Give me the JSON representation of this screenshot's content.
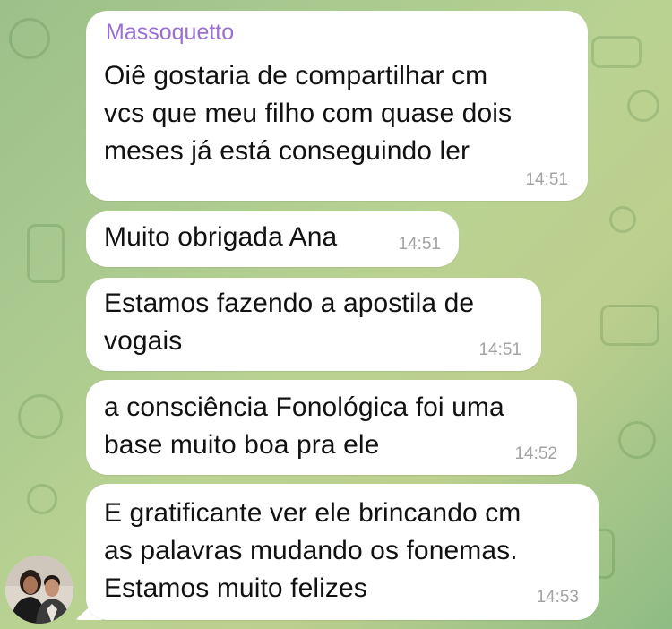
{
  "chat": {
    "messages": [
      {
        "sender": "Massoquetto",
        "text": "Oiê gostaria de compartilhar cm\nvcs que meu filho com quase dois\nmeses já está conseguindo ler",
        "time": "14:51"
      },
      {
        "text": "Muito obrigada Ana",
        "time": "14:51"
      },
      {
        "text": "Estamos fazendo a apostila de\nvogais",
        "time": "14:51"
      },
      {
        "text": "a consciência Fonológica foi uma\nbase muito boa pra ele",
        "time": "14:52"
      },
      {
        "text": "E gratificante ver ele brincando cm\nas palavras mudando os fonemas.\nEstamos muito felizes",
        "time": "14:53"
      }
    ]
  },
  "colors": {
    "sender_name": "#9a6fd2",
    "bubble_bg": "#ffffff",
    "timestamp": "#a3a3a3"
  }
}
